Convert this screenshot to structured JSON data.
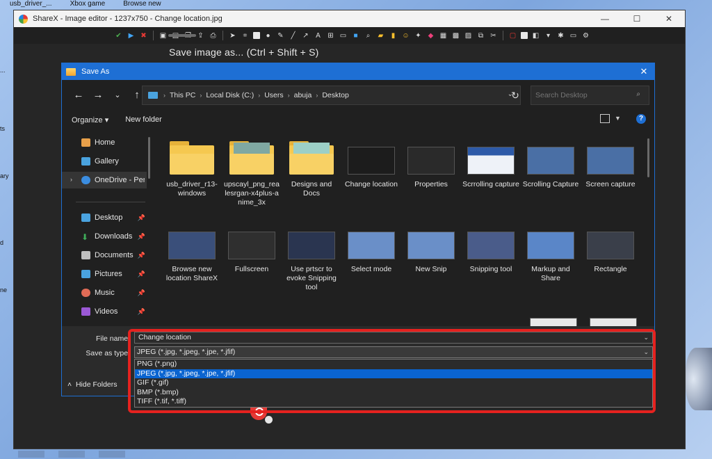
{
  "desktop": {
    "top_icons": [
      "usb_driver_...",
      "Xbox game",
      "Browse new"
    ],
    "left_labels": [
      "...",
      "ts",
      "ary",
      "d",
      "ne"
    ]
  },
  "sharex": {
    "title": "ShareX - Image editor - 1237x750 - Change location.jpg",
    "tooltip": "Save image as... (Ctrl + Shift + S)",
    "window_controls": {
      "minimize": "—",
      "maximize": "☐",
      "close": "✕"
    }
  },
  "dialog": {
    "title": "Save As",
    "close": "✕",
    "nav": {
      "back": "←",
      "forward": "→",
      "down": "⌄",
      "up": "↑"
    },
    "breadcrumb": [
      "This PC",
      "Local Disk (C:)",
      "Users",
      "abuja",
      "Desktop"
    ],
    "search_placeholder": "Search Desktop",
    "toolbar": {
      "organize": "Organize ▾",
      "new_folder": "New folder",
      "help": "?"
    },
    "nav_pane": [
      {
        "label": "Home",
        "icon": "home-icon",
        "color": "#e8a04a"
      },
      {
        "label": "Gallery",
        "icon": "gallery-icon",
        "color": "#4aa3df"
      },
      {
        "label": "OneDrive - Perso",
        "icon": "onedrive-icon",
        "color": "#3b8de0"
      },
      {
        "label": "Desktop",
        "icon": "desktop-icon",
        "color": "#4aa3df"
      },
      {
        "label": "Downloads",
        "icon": "download-icon",
        "color": "#3fae5a"
      },
      {
        "label": "Documents",
        "icon": "documents-icon",
        "color": "#bfbfbf"
      },
      {
        "label": "Pictures",
        "icon": "pictures-icon",
        "color": "#4aa3df"
      },
      {
        "label": "Music",
        "icon": "music-icon",
        "color": "#e06b56"
      },
      {
        "label": "Videos",
        "icon": "videos-icon",
        "color": "#9b59d6"
      }
    ],
    "files": [
      {
        "name": "usb_driver_r13-windows",
        "kind": "folder"
      },
      {
        "name": "upscayl_png_realesrgan-x4plus-anime_3x",
        "kind": "folder"
      },
      {
        "name": "Designs and Docs",
        "kind": "folder"
      },
      {
        "name": "Change location",
        "kind": "image",
        "tint": "#1c1c1c"
      },
      {
        "name": "Properties",
        "kind": "image",
        "tint": "#2a2a2a"
      },
      {
        "name": "Scrrolling capture",
        "kind": "image",
        "tint": "#2d5aa8"
      },
      {
        "name": "Scrolling Capture",
        "kind": "image",
        "tint": "#4a6fa5"
      },
      {
        "name": "Screen capture",
        "kind": "image",
        "tint": "#4a6fa5"
      },
      {
        "name": "Browse new location ShareX",
        "kind": "image",
        "tint": "#3a4f7a"
      },
      {
        "name": "Fullscreen",
        "kind": "image",
        "tint": "#2f2f2f"
      },
      {
        "name": "Use prtscr to evoke Snipping tool",
        "kind": "image",
        "tint": "#2a3550"
      },
      {
        "name": "Select mode",
        "kind": "image",
        "tint": "#6a8fc8"
      },
      {
        "name": "New Snip",
        "kind": "image",
        "tint": "#6a8fc8"
      },
      {
        "name": "Snipping tool",
        "kind": "image",
        "tint": "#4a5c8a"
      },
      {
        "name": "Markup and Share",
        "kind": "image",
        "tint": "#5a86c8"
      },
      {
        "name": "Rectangle",
        "kind": "image",
        "tint": "#3a3f4a"
      }
    ],
    "filename_label": "File name:",
    "filename_value": "Change location",
    "savetype_label": "Save as type:",
    "savetype_value": "JPEG (*.jpg, *.jpeg, *.jpe, *.jfif)",
    "type_options": [
      "PNG (*.png)",
      "JPEG (*.jpg, *.jpeg, *.jpe, *.jfif)",
      "GIF (*.gif)",
      "BMP (*.bmp)",
      "TIFF (*.tif, *.tiff)"
    ],
    "selected_option_index": 1,
    "hide_folders": "Hide Folders"
  },
  "colors": {
    "accent": "#1e6fd4",
    "highlight": "#e5221f",
    "selection": "#0a64d0"
  }
}
